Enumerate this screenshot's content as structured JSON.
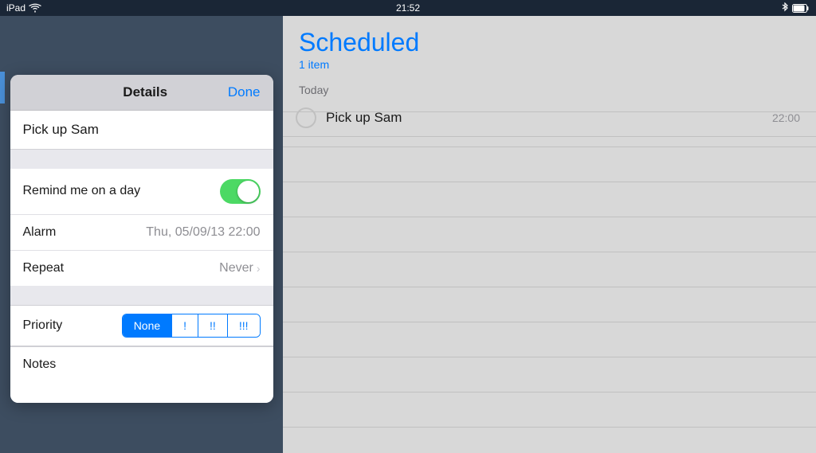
{
  "statusBar": {
    "carrier": "iPad",
    "time": "21:52",
    "wifi": true,
    "battery": true
  },
  "modal": {
    "title": "Details",
    "doneLabel": "Done",
    "taskName": "Pick up Sam",
    "remindLabel": "Remind me on a day",
    "alarmLabel": "Alarm",
    "alarmValue": "Thu, 05/09/13 22:00",
    "repeatLabel": "Repeat",
    "repeatValue": "Never",
    "priorityLabel": "Priority",
    "priorityButtons": [
      "None",
      "!",
      "!!",
      "!!!"
    ],
    "activePriority": "None",
    "notesLabel": "Notes"
  },
  "rightPanel": {
    "title": "Scheduled",
    "count": "1 item",
    "todayLabel": "Today",
    "tasks": [
      {
        "name": "Pick up Sam",
        "time": "22:00"
      }
    ]
  }
}
